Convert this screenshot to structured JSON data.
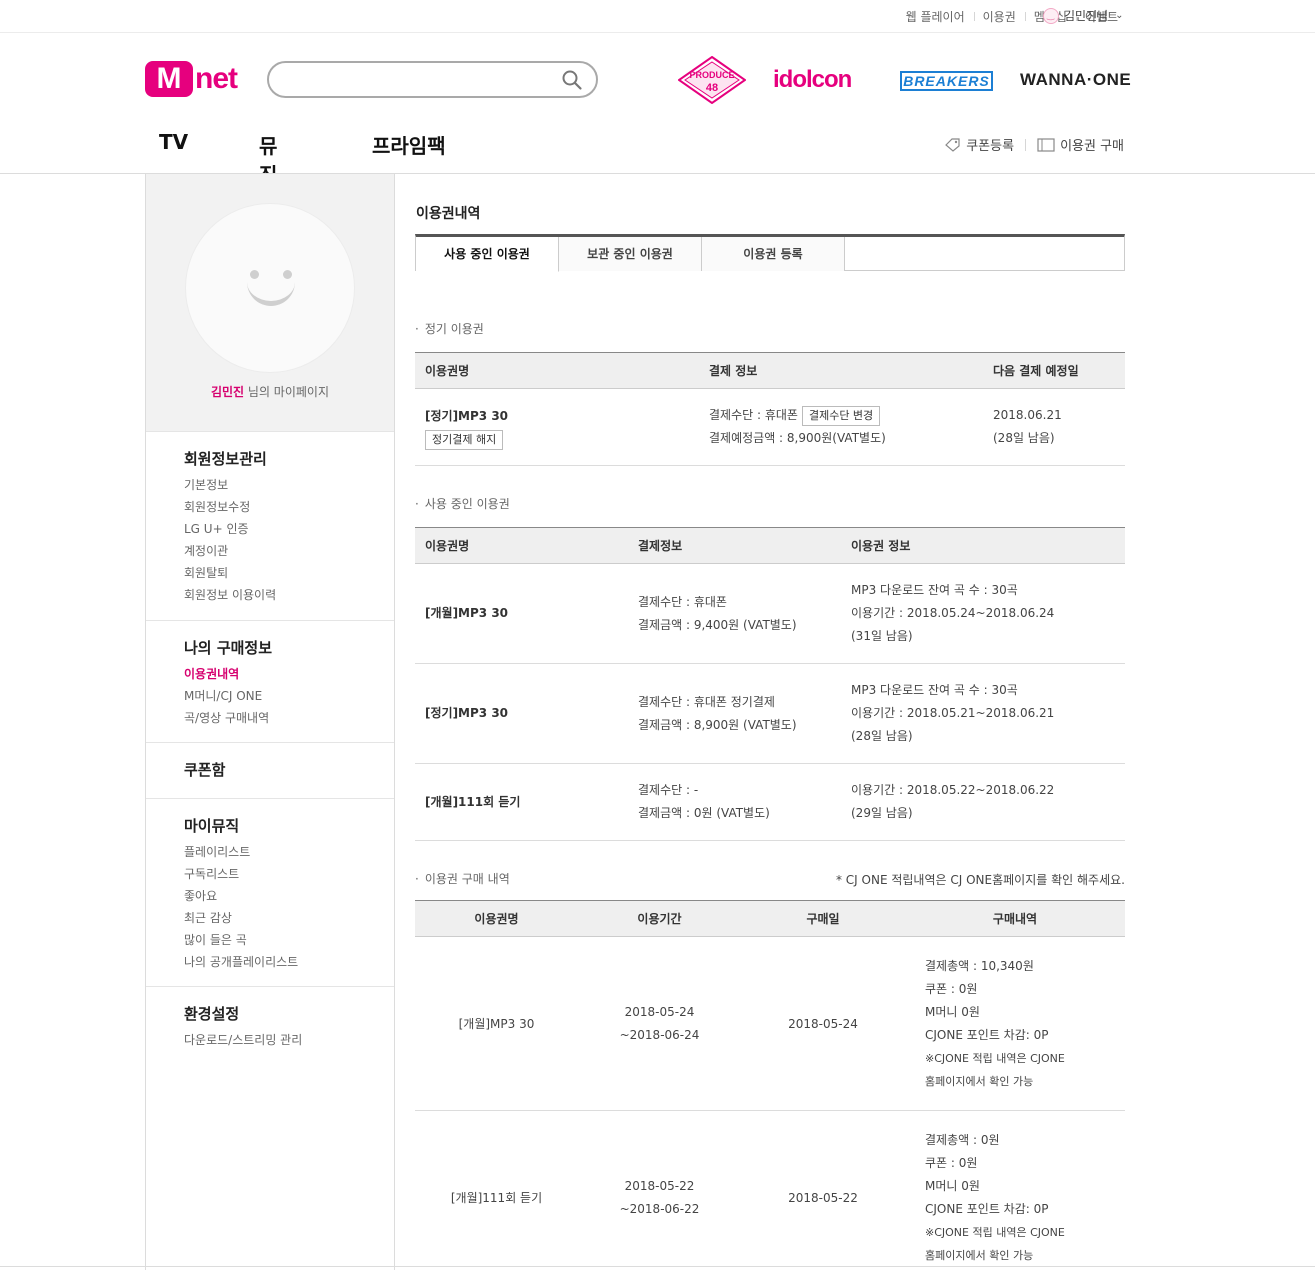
{
  "top_links": [
    "웹 플레이어",
    "이용권",
    "멤버십",
    "이벤트"
  ],
  "user": {
    "name": "김민진님"
  },
  "logo": {
    "m": "M",
    "net": "net"
  },
  "search": {
    "placeholder": ""
  },
  "brands": {
    "produce": "PRODUCE 48",
    "idolcon": "idolcon",
    "breakers": "BREAKERS",
    "wanna": "WANNA·ONE"
  },
  "gnb": [
    "TV",
    "뮤직",
    "프라임팩"
  ],
  "util": {
    "coupon": "쿠폰등록",
    "buy": "이용권 구매"
  },
  "sidebar": {
    "name": "김민진",
    "name_suffix": " 님의 마이페이지",
    "groups": [
      {
        "title": "회원정보관리",
        "items": [
          "기본정보",
          "회원정보수정",
          "LG U+ 인증",
          "계정이관",
          "회원탈퇴",
          "회원정보 이용이력"
        ]
      },
      {
        "title": "나의 구매정보",
        "items": [
          "이용권내역",
          "M머니/CJ ONE",
          "곡/영상 구매내역"
        ]
      },
      {
        "title": "쿠폰함",
        "items": []
      },
      {
        "title": "마이뮤직",
        "items": [
          "플레이리스트",
          "구독리스트",
          "좋아요",
          "최근 감상",
          "많이 들은 곡",
          "나의 공개플레이리스트"
        ]
      },
      {
        "title": "환경설정",
        "items": [
          "다운로드/스트리밍 관리"
        ]
      }
    ]
  },
  "main": {
    "title": "이용권내역",
    "tabs": [
      "사용 중인 이용권",
      "보관 중인 이용권",
      "이용권 등록"
    ],
    "regular": {
      "label": "정기 이용권",
      "headers": [
        "이용권명",
        "결제 정보",
        "다음 결제 예정일"
      ],
      "row": {
        "name": "[정기]MP3 30",
        "cancel_btn": "정기결제 해지",
        "method": "결제수단 : 휴대폰",
        "change_btn": "결제수단 변경",
        "amount": "결제예정금액 : 8,900원(VAT별도)",
        "date": "2018.06.21",
        "remain": "(28일 남음)"
      }
    },
    "active": {
      "label": "사용 중인 이용권",
      "headers": [
        "이용권명",
        "결제정보",
        "이용권 정보"
      ],
      "rows": [
        {
          "name": "[개월]MP3 30",
          "method": "결제수단 : 휴대폰",
          "amount": "결제금액 : 9,400원 (VAT별도)",
          "info1": "MP3 다운로드 잔여 곡 수 : 30곡",
          "info2": "이용기간 : 2018.05.24~2018.06.24",
          "info3": "(31일 남음)"
        },
        {
          "name": "[정기]MP3 30",
          "method": "결제수단 : 휴대폰 정기결제",
          "amount": "결제금액 : 8,900원 (VAT별도)",
          "info1": "MP3 다운로드 잔여 곡 수 : 30곡",
          "info2": "이용기간 : 2018.05.21~2018.06.21",
          "info3": "(28일 남음)"
        },
        {
          "name": "[개월]111회 듣기",
          "method": "결제수단 : -",
          "amount": "결제금액 : 0원 (VAT별도)",
          "info1": "이용기간 : 2018.05.22~2018.06.22",
          "info2": "(29일 남음)",
          "info3": ""
        }
      ]
    },
    "history": {
      "label": "이용권 구매 내역",
      "notice": "* CJ ONE 적립내역은 CJ ONE홈페이지를 확인 해주세요.",
      "headers": [
        "이용권명",
        "이용기간",
        "구매일",
        "구매내역"
      ],
      "rows": [
        {
          "name": "[개월]MP3 30",
          "period1": "2018-05-24",
          "period2": "~2018-06-24",
          "date": "2018-05-24",
          "total": "결제총액 : 10,340원",
          "coupon": "쿠폰 : 0원",
          "mmoney": "M머니 0원",
          "cjone": "CJONE 포인트 차감: 0P",
          "note1": "※CJONE 적립 내역은 CJONE",
          "note2": "홈페이지에서 확인 가능"
        },
        {
          "name": "[개월]111회 듣기",
          "period1": "2018-05-22",
          "period2": "~2018-06-22",
          "date": "2018-05-22",
          "total": "결제총액 : 0원",
          "coupon": "쿠폰 : 0원",
          "mmoney": "M머니 0원",
          "cjone": "CJONE 포인트 차감: 0P",
          "note1": "※CJONE 적립 내역은 CJONE",
          "note2": "홈페이지에서 확인 가능"
        }
      ]
    }
  },
  "colors": {
    "brand": "#e6007e",
    "active_menu": "#d6006f"
  }
}
